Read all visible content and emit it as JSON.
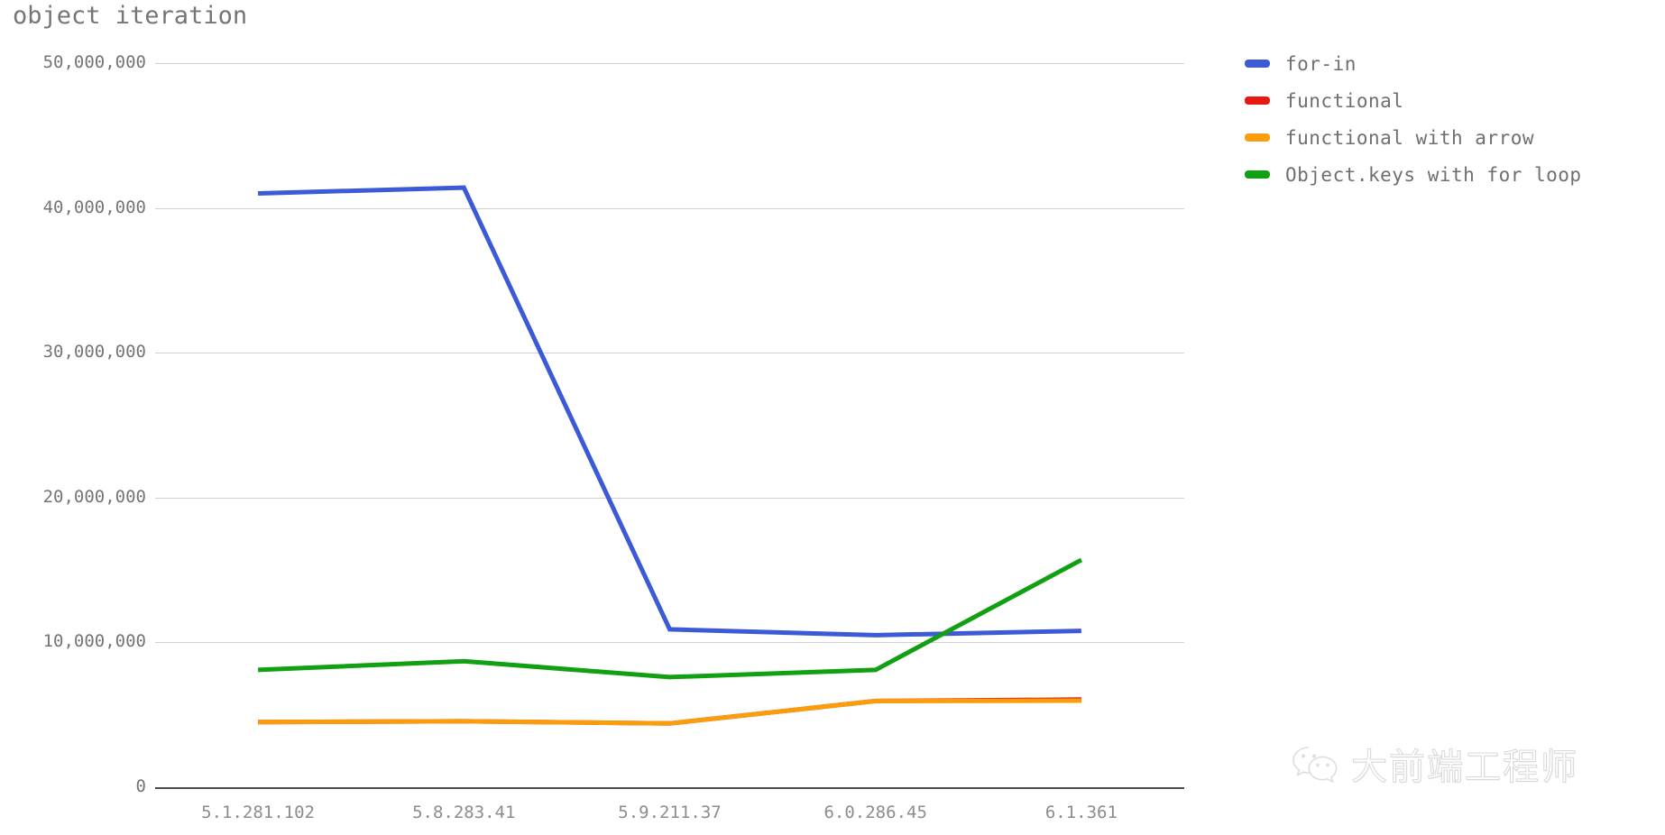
{
  "chart_data": {
    "type": "line",
    "title": "object iteration",
    "xlabel": "",
    "ylabel": "",
    "categories": [
      "5.1.281.102",
      "5.8.283.41",
      "5.9.211.37",
      "6.0.286.45",
      "6.1.361"
    ],
    "ylim": [
      0,
      50000000
    ],
    "yticks": [
      0,
      10000000,
      20000000,
      30000000,
      40000000,
      50000000
    ],
    "ytick_labels": [
      "0",
      "10,000,000",
      "20,000,000",
      "30,000,000",
      "40,000,000",
      "50,000,000"
    ],
    "grid": true,
    "legend_position": "right",
    "series": [
      {
        "name": "for-in",
        "color": "#3c5ad6",
        "values": [
          41000000,
          41400000,
          10900000,
          10500000,
          10800000
        ]
      },
      {
        "name": "functional",
        "color": "#e8170f",
        "values": [
          4500000,
          4550000,
          4400000,
          5950000,
          6050000
        ]
      },
      {
        "name": "functional with arrow",
        "color": "#f99d0d",
        "values": [
          4500000,
          4550000,
          4400000,
          5950000,
          5980000
        ]
      },
      {
        "name": "Object.keys with for loop",
        "color": "#11a011",
        "values": [
          8100000,
          8700000,
          7600000,
          8100000,
          15700000
        ]
      }
    ]
  },
  "legend": {
    "items": [
      {
        "label": "for-in",
        "color": "#3c5ad6"
      },
      {
        "label": "functional",
        "color": "#e8170f"
      },
      {
        "label": "functional with arrow",
        "color": "#f99d0d"
      },
      {
        "label": "Object.keys with for loop",
        "color": "#11a011"
      }
    ]
  },
  "watermark": {
    "icon": "wechat-icon",
    "text": "大前端工程师"
  }
}
